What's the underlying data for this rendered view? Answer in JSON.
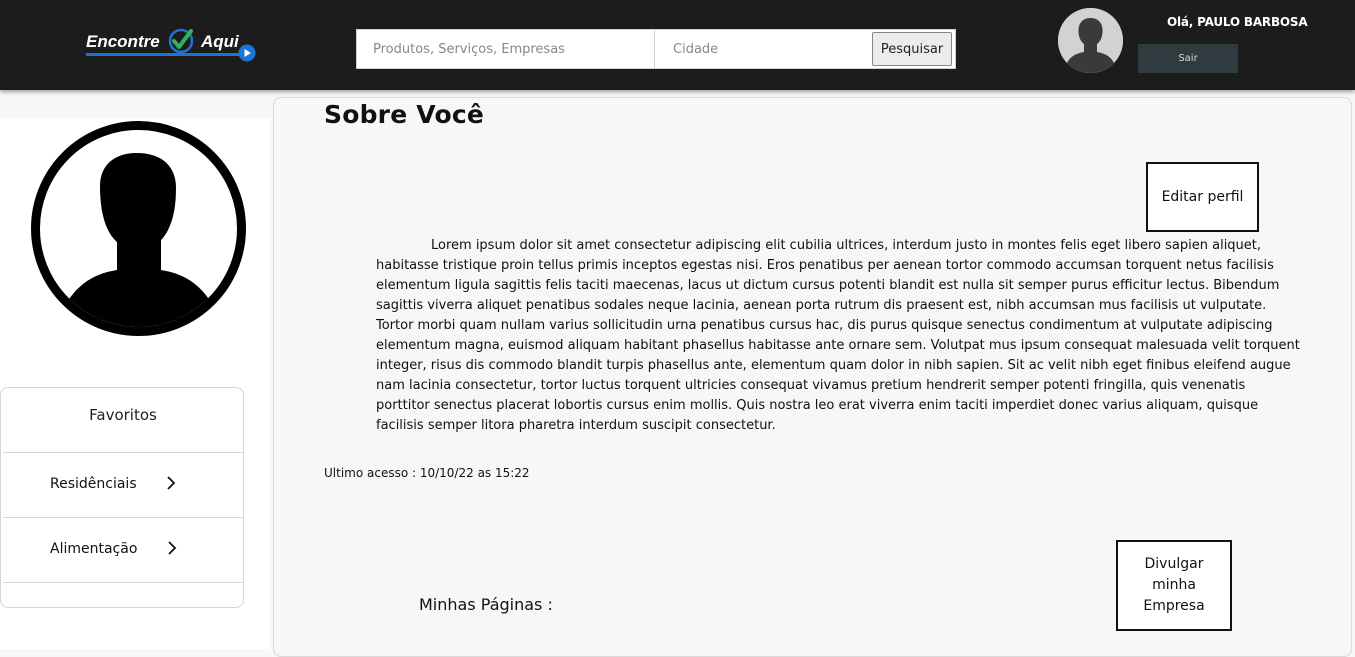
{
  "header": {
    "logo": {
      "word_left": "Encontre",
      "word_right": "Aqui",
      "brand_color": "#1e73d8",
      "check_color": "#2fb35a"
    },
    "search": {
      "products_placeholder": "Produtos, Serviços, Empresas",
      "city_placeholder": "Cidade",
      "button_label": "Pesquisar"
    },
    "user": {
      "greeting": "Olá, PAULO BARBOSA",
      "logout_label": "Sair"
    }
  },
  "sidebar": {
    "favorites_title": "Favoritos",
    "items": [
      {
        "label": "Residênciais",
        "icon": "chevron-right-icon"
      },
      {
        "label": "Alimentação",
        "icon": "chevron-right-icon"
      }
    ]
  },
  "main": {
    "title": "Sobre Você",
    "edit_label": "Editar perfil",
    "about_text": "Lorem ipsum dolor sit amet consectetur adipiscing elit cubilia ultrices, interdum justo in montes felis eget libero sapien aliquet, habitasse tristique proin tellus primis inceptos egestas nisi. Eros penatibus per aenean tortor commodo accumsan torquent netus facilisis elementum ligula sagittis felis taciti maecenas, lacus ut dictum cursus potenti blandit est nulla sit semper purus efficitur lectus. Bibendum sagittis viverra aliquet penatibus sodales neque lacinia, aenean porta rutrum dis praesent est, nibh accumsan mus facilisis ut vulputate. Tortor morbi quam nullam varius sollicitudin urna penatibus cursus hac, dis purus quisque senectus condimentum at vulputate adipiscing elementum magna, euismod aliquam habitant phasellus habitasse ante ornare sem. Volutpat mus ipsum consequat malesuada velit torquent integer, risus dis commodo blandit turpis phasellus ante, elementum quam dolor in nibh sapien. Sit ac velit nibh eget finibus eleifend augue nam lacinia consectetur, tortor luctus torquent ultricies consequat vivamus pretium hendrerit semper potenti fringilla, quis venenatis porttitor senectus placerat lobortis cursus enim mollis. Quis nostra leo erat viverra enim taciti imperdiet donec varius aliquam, quisque facilisis semper litora pharetra interdum suscipit consectetur.",
    "last_access": "Ultimo acesso : 10/10/22 as 15:22",
    "promote_label": "Divulgar minha Empresa",
    "my_pages_label": "Minhas Páginas :"
  }
}
